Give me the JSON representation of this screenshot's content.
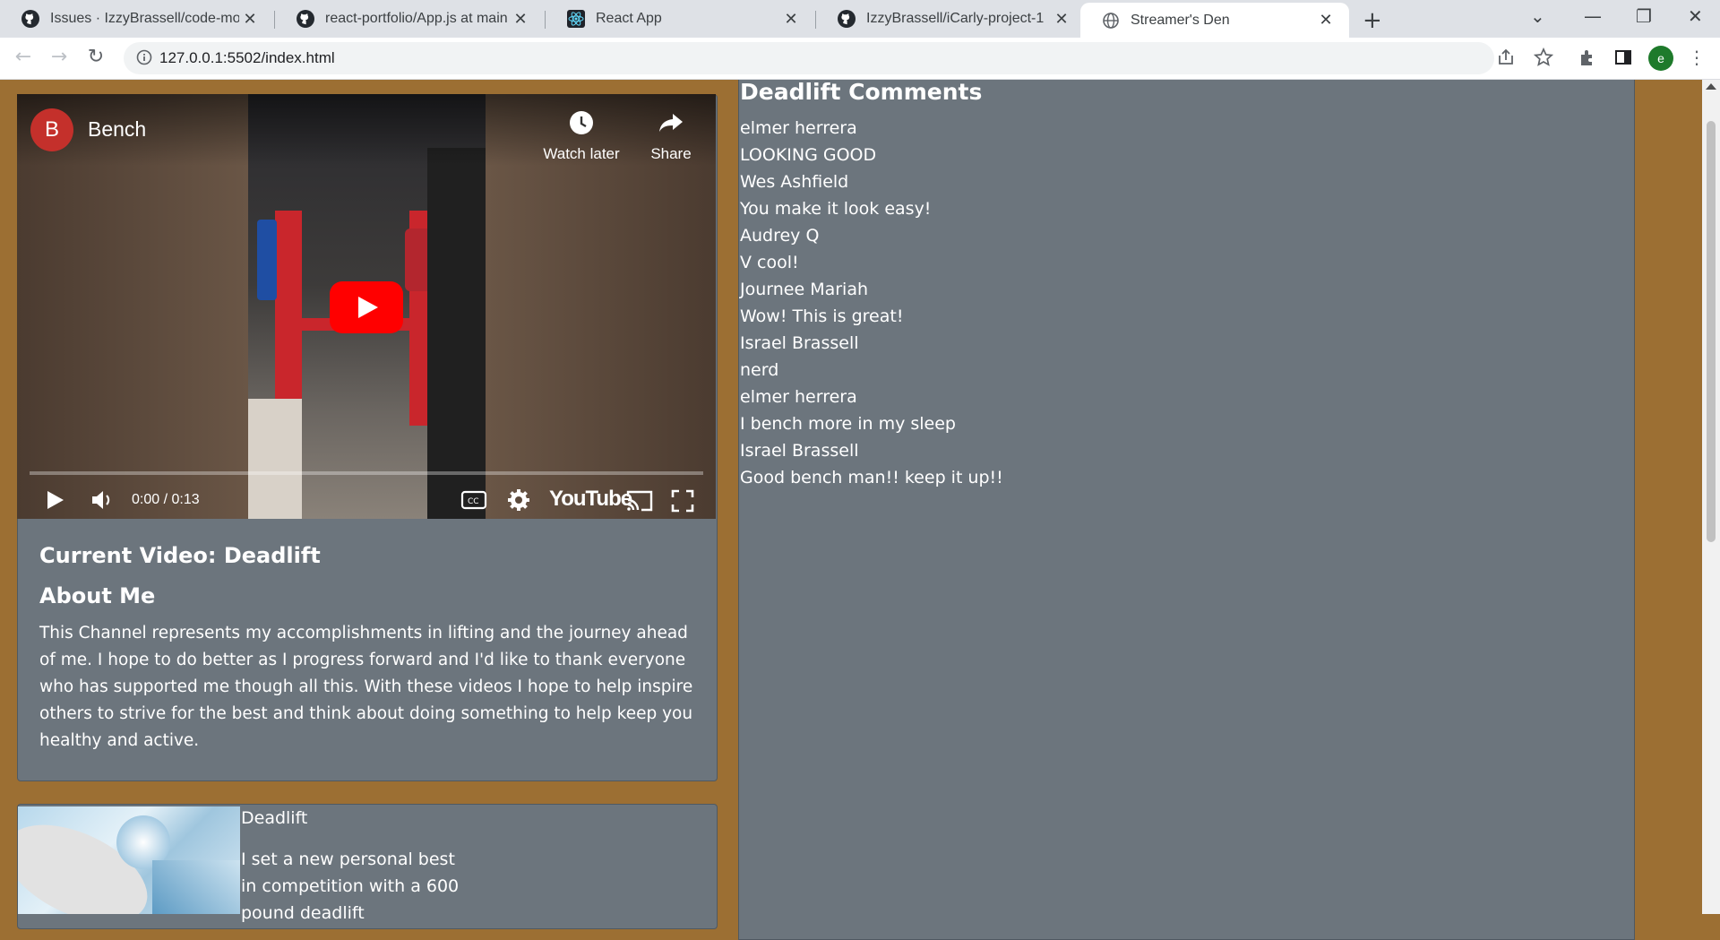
{
  "browser": {
    "tabs": [
      {
        "title": "Issues · IzzyBrassell/code-monste",
        "icon": "github-icon"
      },
      {
        "title": "react-portfolio/App.js at main · Iz",
        "icon": "github-icon"
      },
      {
        "title": "React App",
        "icon": "react-icon"
      },
      {
        "title": "IzzyBrassell/iCarly-project-1",
        "icon": "github-icon"
      },
      {
        "title": "Streamer's Den",
        "icon": "globe-icon",
        "active": true
      }
    ],
    "url": "127.0.0.1:5502/index.html",
    "profile_initial": "e"
  },
  "video": {
    "channel_initial": "B",
    "title": "Bench",
    "watch_later": "Watch later",
    "share": "Share",
    "time": "0:00 / 0:13",
    "brand": "YouTube"
  },
  "about": {
    "current_video": "Current Video: Deadlift",
    "heading": "About Me",
    "text": "This Channel represents my accomplishments in lifting and the journey ahead of me. I hope to do better as I progress forward and I'd like to thank everyone who has supported me though all this. With these videos I hope to help inspire others to strive for the best and think about doing something to help keep you healthy and active."
  },
  "comments": {
    "title": "Deadlift Comments",
    "items": [
      "elmer herrera",
      "LOOKING GOOD",
      "Wes Ashfield",
      "You make it look easy!",
      "Audrey Q",
      "V cool!",
      "Journee Mariah",
      "Wow! This is great!",
      "Israel Brassell",
      "nerd",
      "elmer herrera",
      "I bench more in my sleep",
      "Israel Brassell",
      "Good bench man!! keep it up!!"
    ]
  },
  "video_list": {
    "item_title": "Deadlift",
    "item_text": "I set a new personal best in competition with a 600 pound deadlift"
  },
  "colors": {
    "page_bg": "#9c6f33",
    "card_bg": "#6c757d",
    "youtube_red": "#ff0000"
  }
}
